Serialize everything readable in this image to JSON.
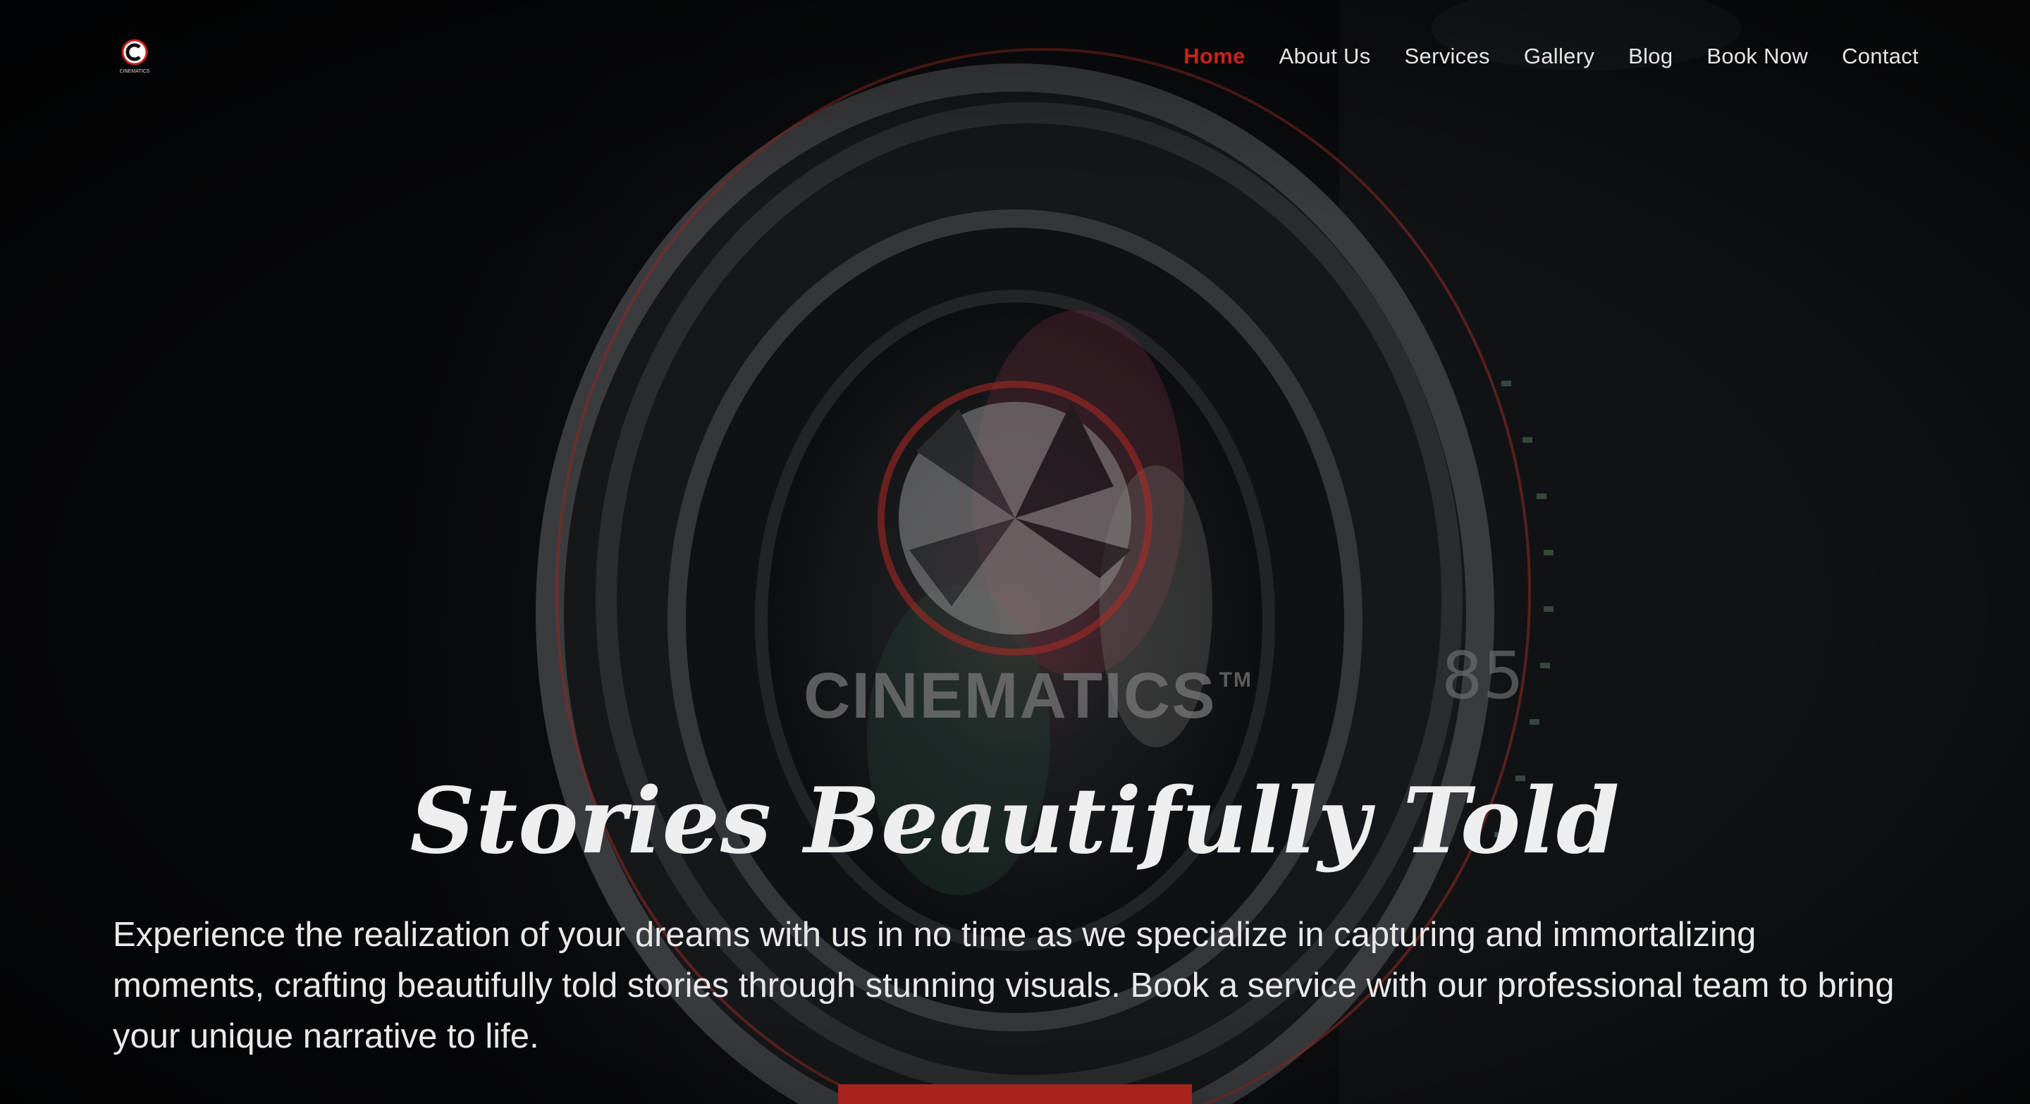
{
  "brand": {
    "logo_text": "CINEMATICS",
    "watermark_text": "CINEMATICS",
    "watermark_mark": "TM",
    "accent_color": "#c4241c"
  },
  "nav": {
    "items": [
      {
        "label": "Home",
        "active": true
      },
      {
        "label": "About Us"
      },
      {
        "label": "Services"
      },
      {
        "label": "Gallery"
      },
      {
        "label": "Blog"
      },
      {
        "label": "Book Now"
      },
      {
        "label": "Contact"
      }
    ]
  },
  "hero": {
    "headline": "Stories Beautifully Told",
    "lead": "Experience the realization of your dreams with us in no time as we specialize in capturing and immortalizing moments, crafting beautifully told stories through stunning visuals. Book a service with our professional team to bring your unique narrative to life.",
    "lens_number": "85"
  }
}
